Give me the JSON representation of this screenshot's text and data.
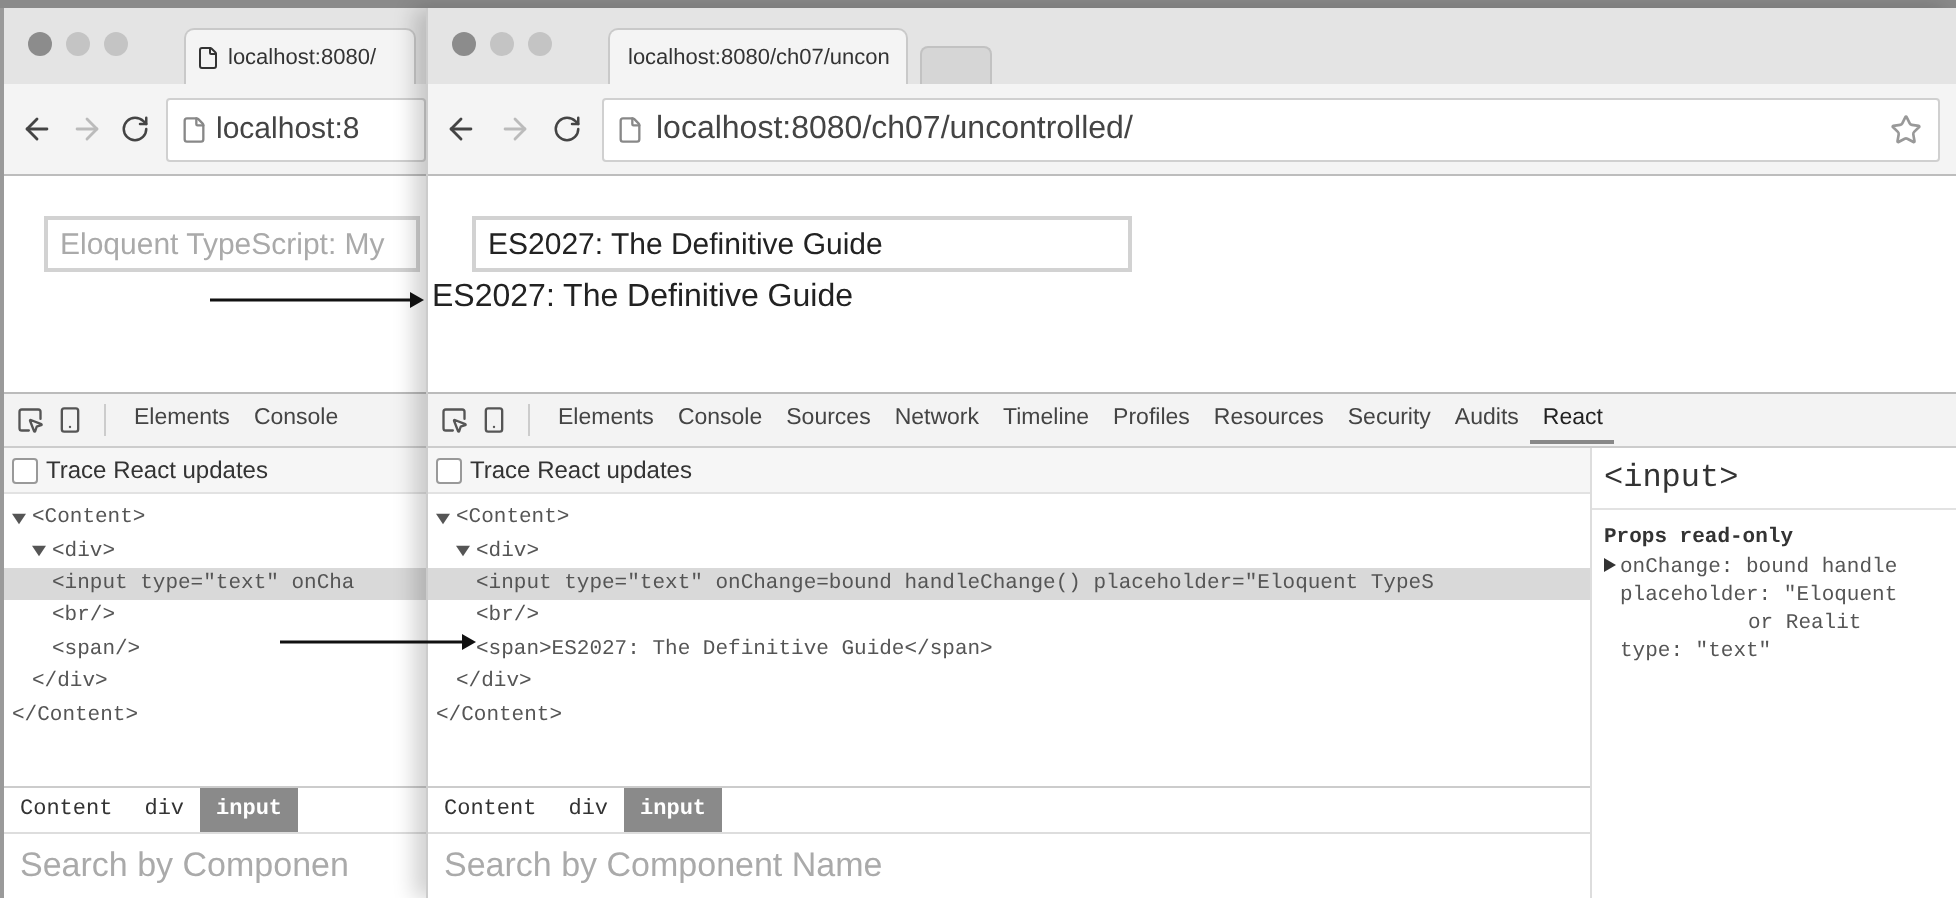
{
  "back_window": {
    "tab_title": "localhost:8080/",
    "address": "localhost:8",
    "page_input": {
      "placeholder": "Eloquent TypeScript: My"
    },
    "devtools": {
      "tabs": [
        {
          "label": "Elements",
          "selected": false
        },
        {
          "label": "Console",
          "selected": false
        }
      ],
      "trace_checkbox": {
        "label": "Trace React updates",
        "checked": false
      },
      "tree": [
        {
          "open": "<Content>",
          "expanded": true,
          "selected": false,
          "close": "</Content>",
          "children": [
            {
              "open": "<div>",
              "expanded": true,
              "selected": false,
              "close": "</div>",
              "children": [
                {
                  "open": "<input type=\"text\" onCha",
                  "selected": true
                },
                {
                  "open": "<br/>",
                  "selected": false
                },
                {
                  "open": "<span/>",
                  "selected": false
                }
              ]
            }
          ]
        }
      ],
      "breadcrumbs": [
        {
          "label": "Content",
          "selected": false
        },
        {
          "label": "div",
          "selected": false
        },
        {
          "label": "input",
          "selected": true
        }
      ],
      "search": {
        "placeholder": "Search by Componen"
      }
    }
  },
  "front_window": {
    "tab_title": "localhost:8080/ch07/uncon",
    "address": "localhost:8080/ch07/uncontrolled/",
    "page_input": {
      "value": "ES2027: The Definitive Guide"
    },
    "page_output": "ES2027: The Definitive Guide",
    "devtools": {
      "tabs": [
        {
          "label": "Elements",
          "selected": false
        },
        {
          "label": "Console",
          "selected": false
        },
        {
          "label": "Sources",
          "selected": false
        },
        {
          "label": "Network",
          "selected": false
        },
        {
          "label": "Timeline",
          "selected": false
        },
        {
          "label": "Profiles",
          "selected": false
        },
        {
          "label": "Resources",
          "selected": false
        },
        {
          "label": "Security",
          "selected": false
        },
        {
          "label": "Audits",
          "selected": false
        },
        {
          "label": "React",
          "selected": true
        }
      ],
      "trace_checkbox": {
        "label": "Trace React updates",
        "checked": false
      },
      "tree": [
        {
          "open": "<Content>",
          "expanded": true,
          "selected": false,
          "close": "</Content>",
          "children": [
            {
              "open": "<div>",
              "expanded": true,
              "selected": false,
              "close": "</div>",
              "children": [
                {
                  "open": "<input type=\"text\" onChange=bound handleChange() placeholder=\"Eloquent TypeS",
                  "selected": true
                },
                {
                  "open": "<br/>",
                  "selected": false
                },
                {
                  "open": "<span>ES2027: The Definitive Guide</span>",
                  "selected": false
                }
              ]
            }
          ]
        }
      ],
      "breadcrumbs": [
        {
          "label": "Content",
          "selected": false
        },
        {
          "label": "div",
          "selected": false
        },
        {
          "label": "input",
          "selected": true
        }
      ],
      "search": {
        "placeholder": "Search by Component Name"
      },
      "sidebar": {
        "title": "<input>",
        "section": "Props read-only",
        "props": [
          {
            "kind": "expandable",
            "text": "onChange: bound handle"
          },
          {
            "kind": "plain",
            "text": "placeholder: \"Eloquent"
          },
          {
            "kind": "continued",
            "text": "or Realit"
          },
          {
            "kind": "plain",
            "text": "type: \"text\""
          }
        ]
      }
    }
  }
}
